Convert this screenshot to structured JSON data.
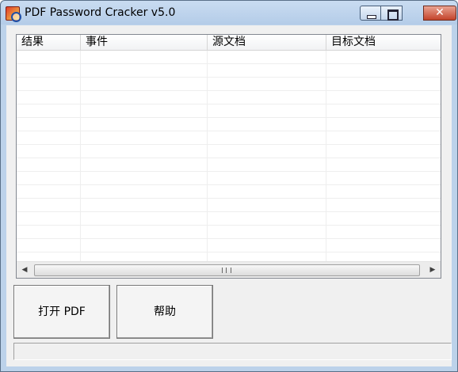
{
  "window": {
    "title": "PDF Password Cracker v5.0",
    "close_glyph": "✕",
    "icons": {
      "app": "pdf-cracker-app-icon",
      "minimize": "minimize-icon",
      "maximize": "maximize-icon",
      "close": "close-icon"
    }
  },
  "list": {
    "columns": [
      "结果",
      "事件",
      "源文档",
      "目标文档"
    ],
    "rows": []
  },
  "scrollbar": {
    "left_arrow": "◀",
    "right_arrow": "▶"
  },
  "buttons": {
    "open_pdf": "打开 PDF",
    "help": "帮助"
  },
  "status": {
    "text": ""
  }
}
